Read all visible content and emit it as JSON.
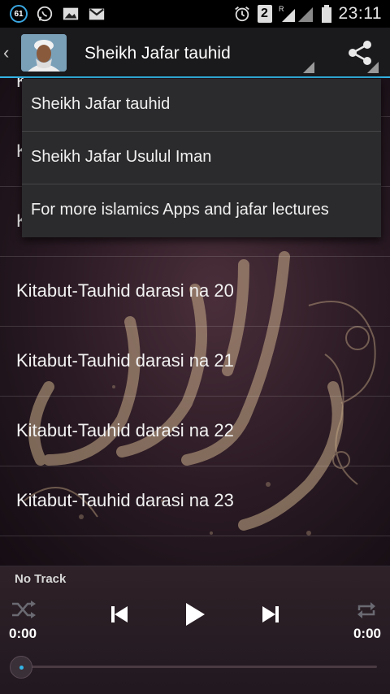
{
  "status_bar": {
    "notification_count": "61",
    "sim_badge": "2",
    "roaming_indicator": "R",
    "time": "23:11",
    "icons": [
      "whatsapp-icon",
      "image-icon",
      "gmail-icon",
      "alarm-icon",
      "signal-icon",
      "battery-icon"
    ]
  },
  "action_bar": {
    "title": "Sheikh Jafar tauhid",
    "accent": "#33b5e5"
  },
  "dropdown": {
    "items": [
      {
        "label": "Sheikh Jafar tauhid"
      },
      {
        "label": "Sheikh Jafar Usulul Iman"
      },
      {
        "label": "For more islamics Apps and jafar lectures"
      }
    ]
  },
  "list": {
    "partial_prefix": "K",
    "items": [
      {
        "label": "Kitabut-Tauhid darasi na 20"
      },
      {
        "label": "Kitabut-Tauhid darasi na 21"
      },
      {
        "label": "Kitabut-Tauhid darasi na 22"
      },
      {
        "label": "Kitabut-Tauhid darasi na 23"
      }
    ]
  },
  "player": {
    "track": "No Track",
    "time_elapsed": "0:00",
    "time_total": "0:00",
    "progress": 0
  }
}
